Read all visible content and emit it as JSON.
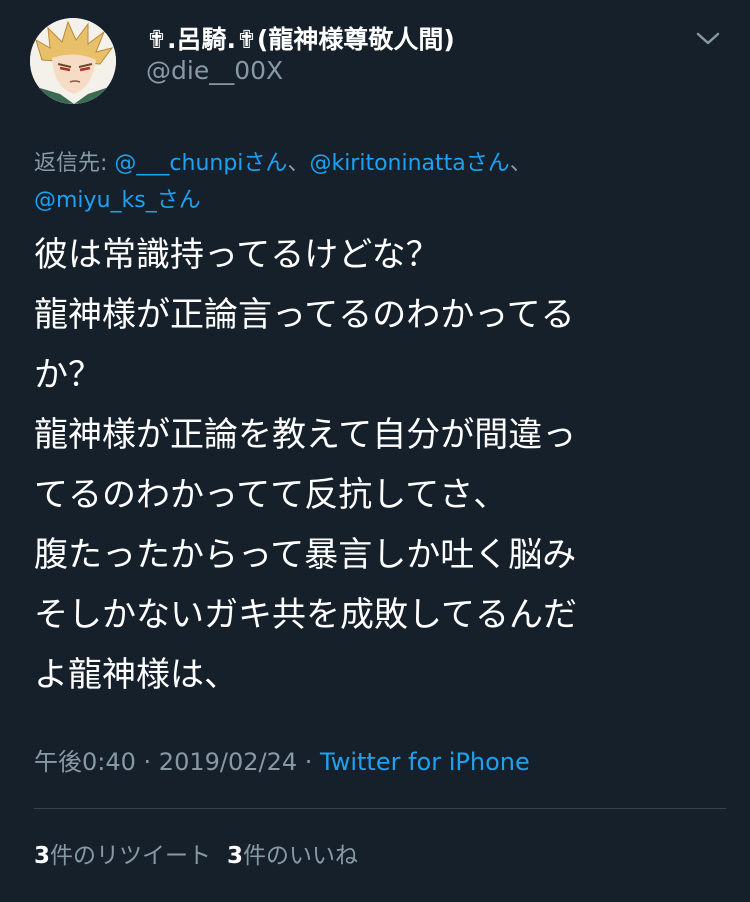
{
  "author": {
    "display_name": "✟.呂騎.✟(龍神様尊敬人間)",
    "handle": "@die__00X"
  },
  "reply_to": {
    "prefix": "返信先: ",
    "mentions": [
      "@___chunpi",
      "@kiritoninatta",
      "@miyu_ks_"
    ],
    "suffix": "さん",
    "separator": "、"
  },
  "tweet": {
    "lines": [
      "彼は常識持ってるけどな？",
      "龍神様が正論言ってるのわかってる",
      "か？",
      "龍神様が正論を教えて自分が間違っ",
      "てるのわかってて反抗してさ、",
      "腹たったからって暴言しか吐く脳み",
      "そしかないガキ共を成敗してるんだ",
      "よ龍神様は、"
    ]
  },
  "meta": {
    "time": "午後0:40",
    "dot": " · ",
    "date": "2019/02/24",
    "source": "Twitter for iPhone"
  },
  "stats": {
    "retweet_count": "3",
    "retweet_label": "件のリツイート",
    "like_count": "3",
    "like_label": "件のいいね"
  },
  "colors": {
    "background": "#15202b",
    "secondary_text": "#8899a6",
    "link": "#1da1f2",
    "divider": "#38444d"
  },
  "icons": {
    "menu": "chevron-down-icon",
    "avatar": "avatar"
  }
}
